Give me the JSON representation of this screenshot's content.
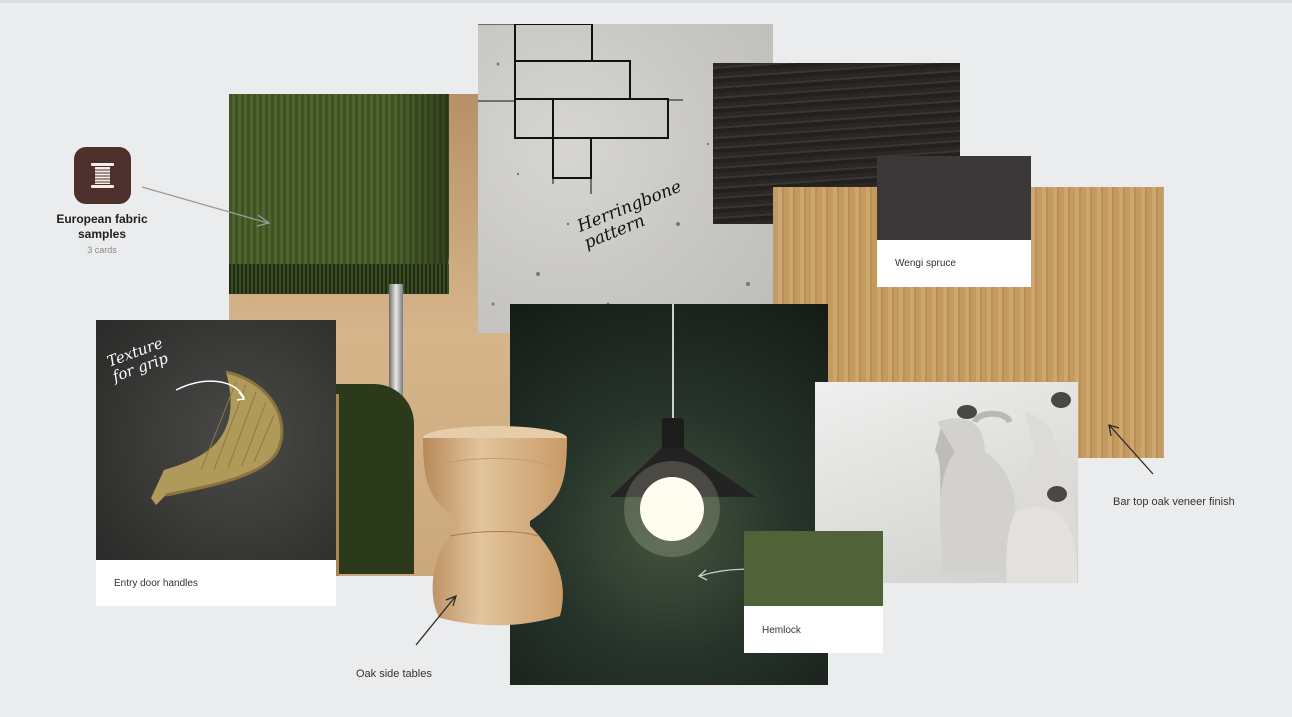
{
  "fabric_group": {
    "title": "European fabric samples",
    "count": "3 cards",
    "icon": "spool-icon",
    "icon_color": "#4d302b"
  },
  "cards": {
    "door_handles": {
      "caption": "Entry door handles",
      "note": "Texture for grip"
    },
    "stone": {
      "note": "Herringbone pattern"
    },
    "wengi": {
      "caption": "Wengi spruce",
      "swatch_color": "#3a3838"
    },
    "hemlock": {
      "caption": "Hemlock",
      "swatch_color": "#4f6238"
    }
  },
  "annotations": {
    "oak_side_tables": "Oak side tables",
    "bar_top": "Bar top oak veneer finish"
  }
}
